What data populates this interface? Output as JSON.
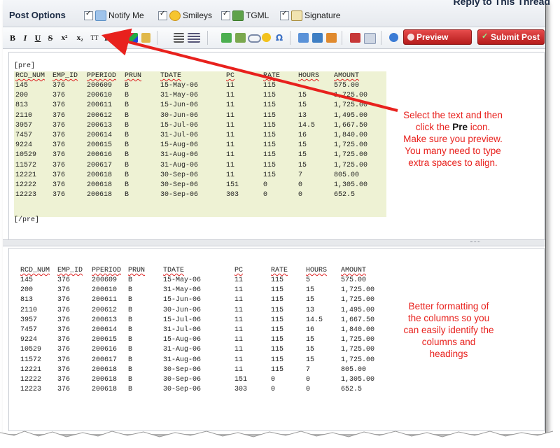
{
  "header": {
    "title": "Reply to This Thread"
  },
  "post_options": {
    "title": "Post Options",
    "items": [
      {
        "label": "Notify Me"
      },
      {
        "label": "Smileys"
      },
      {
        "label": "TGML"
      },
      {
        "label": "Signature"
      }
    ]
  },
  "toolbar": {
    "bold": "B",
    "italic": "I",
    "underline": "U",
    "strike": "S",
    "superscript": "x²",
    "subscript": "x₂",
    "teletype": "TT",
    "pre": "Pre",
    "preview_label": "Preview",
    "submit_label": "Submit Post"
  },
  "editor": {
    "open_tag": "[pre]",
    "close_tag": "[/pre]",
    "headers": [
      "RCD_NUM",
      "EMP_ID",
      "PPERIOD",
      "PRUN",
      "TDATE",
      "PC",
      "RATE",
      "HOURS",
      "AMOUNT"
    ],
    "rows": [
      [
        "145",
        "376",
        "200609",
        "B",
        "15-May-06",
        "11",
        "115",
        "",
        "575.00"
      ],
      [
        "200",
        "376",
        "200610",
        "B",
        "31-May-06",
        "11",
        "115",
        "15",
        "1,725.00"
      ],
      [
        "813",
        "376",
        "200611",
        "B",
        "15-Jun-06",
        "11",
        "115",
        "15",
        "1,725.00"
      ],
      [
        "2110",
        "376",
        "200612",
        "B",
        "30-Jun-06",
        "11",
        "115",
        "13",
        "1,495.00"
      ],
      [
        "3957",
        "376",
        "200613",
        "B",
        "15-Jul-06",
        "11",
        "115",
        "14.5",
        "1,667.50"
      ],
      [
        "7457",
        "376",
        "200614",
        "B",
        "31-Jul-06",
        "11",
        "115",
        "16",
        "1,840.00"
      ],
      [
        "9224",
        "376",
        "200615",
        "B",
        "15-Aug-06",
        "11",
        "115",
        "15",
        "1,725.00"
      ],
      [
        "10529",
        "376",
        "200616",
        "B",
        "31-Aug-06",
        "11",
        "115",
        "15",
        "1,725.00"
      ],
      [
        "11572",
        "376",
        "200617",
        "B",
        "31-Aug-06",
        "11",
        "115",
        "15",
        "1,725.00"
      ],
      [
        "12221",
        "376",
        "200618",
        "B",
        "30-Sep-06",
        "11",
        "115",
        "7",
        "805.00"
      ],
      [
        "12222",
        "376",
        "200618",
        "B",
        "30-Sep-06",
        "151",
        "0",
        "0",
        "1,305.00"
      ],
      [
        "12223",
        "376",
        "200618",
        "B",
        "30-Sep-06",
        "303",
        "0",
        "0",
        "652.5"
      ]
    ]
  },
  "preview": {
    "headers": [
      "RCD_NUM",
      "EMP_ID",
      "PPERIOD",
      "PRUN",
      "TDATE",
      "PC",
      "RATE",
      "HOURS",
      "AMOUNT"
    ],
    "rows": [
      [
        "145",
        "376",
        "200609",
        "B",
        "15-May-06",
        "11",
        "115",
        "5",
        "575.00"
      ],
      [
        "200",
        "376",
        "200610",
        "B",
        "31-May-06",
        "11",
        "115",
        "15",
        "1,725.00"
      ],
      [
        "813",
        "376",
        "200611",
        "B",
        "15-Jun-06",
        "11",
        "115",
        "15",
        "1,725.00"
      ],
      [
        "2110",
        "376",
        "200612",
        "B",
        "30-Jun-06",
        "11",
        "115",
        "13",
        "1,495.00"
      ],
      [
        "3957",
        "376",
        "200613",
        "B",
        "15-Jul-06",
        "11",
        "115",
        "14.5",
        "1,667.50"
      ],
      [
        "7457",
        "376",
        "200614",
        "B",
        "31-Jul-06",
        "11",
        "115",
        "16",
        "1,840.00"
      ],
      [
        "9224",
        "376",
        "200615",
        "B",
        "15-Aug-06",
        "11",
        "115",
        "15",
        "1,725.00"
      ],
      [
        "10529",
        "376",
        "200616",
        "B",
        "31-Aug-06",
        "11",
        "115",
        "15",
        "1,725.00"
      ],
      [
        "11572",
        "376",
        "200617",
        "B",
        "31-Aug-06",
        "11",
        "115",
        "15",
        "1,725.00"
      ],
      [
        "12221",
        "376",
        "200618",
        "B",
        "30-Sep-06",
        "11",
        "115",
        "7",
        "805.00"
      ],
      [
        "12222",
        "376",
        "200618",
        "B",
        "30-Sep-06",
        "151",
        "0",
        "0",
        "1,305.00"
      ],
      [
        "12223",
        "376",
        "200618",
        "B",
        "30-Sep-06",
        "303",
        "0",
        "0",
        "652.5"
      ]
    ]
  },
  "annotations": {
    "top": [
      "Select the text and then",
      "click the ",
      "Pre",
      " icon.",
      "Make sure you preview.",
      "You many need to type",
      "extra spaces to align."
    ],
    "bottom": [
      "Better formatting of",
      "the columns so you",
      "can easily identify the",
      "columns and",
      "headings"
    ]
  },
  "colors": {
    "annotation": "#e8211d",
    "highlight": "#eef2d4",
    "button": "#c62828"
  }
}
